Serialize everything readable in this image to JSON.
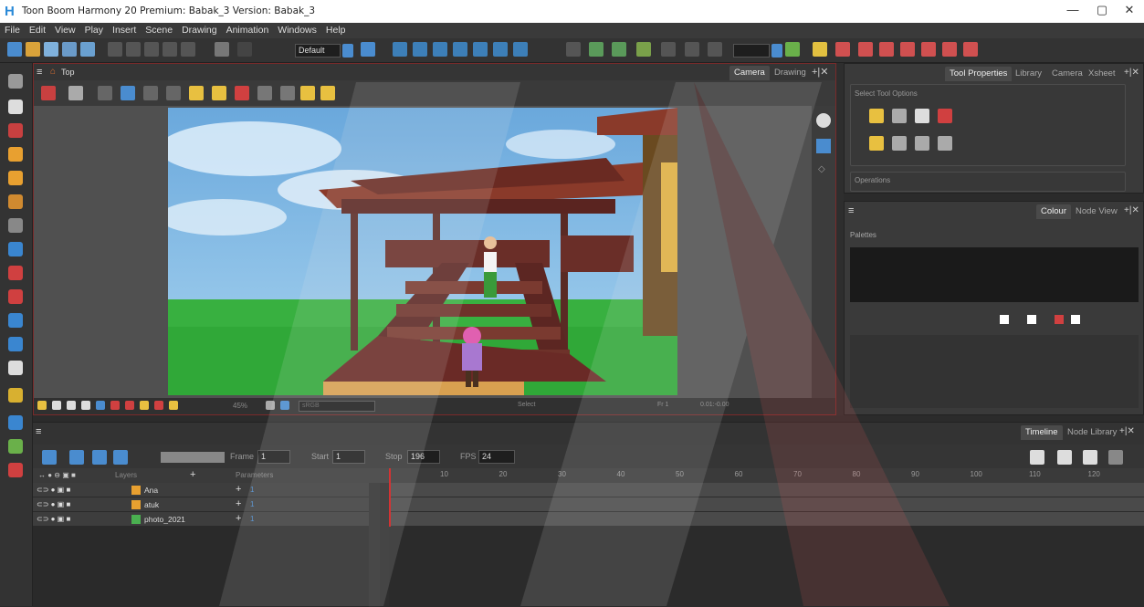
{
  "window": {
    "title": "Toon Boom Harmony 20 Premium: Babak_3 Version: Babak_3",
    "minimize": "—",
    "maximize": "▢",
    "close": "✕"
  },
  "menu": [
    "File",
    "Edit",
    "View",
    "Play",
    "Insert",
    "Scene",
    "Drawing",
    "Animation",
    "Windows",
    "Help"
  ],
  "toolbar": {
    "workspace": "Default"
  },
  "view": {
    "breadcrumb": "Top",
    "tabs": [
      "Camera",
      "Drawing"
    ],
    "footer": {
      "zoom": "45%",
      "colorspace": "sRGB",
      "status": "Select",
      "frame": "Fr 1",
      "coords": "0.01:-0.00"
    }
  },
  "right_top": {
    "tabs": [
      "Tool Properties",
      "Library",
      "Camera",
      "Xsheet"
    ],
    "select_tool_options": "Select Tool Options",
    "operations": "Operations"
  },
  "right_bottom": {
    "tabs": [
      "Colour",
      "Node View"
    ],
    "palettes": "Palettes"
  },
  "timeline": {
    "tabs": [
      "Timeline",
      "Node Library"
    ],
    "frame_label": "Frame",
    "frame": "1",
    "start_label": "Start",
    "start": "1",
    "stop_label": "Stop",
    "stop": "196",
    "fps_label": "FPS",
    "fps": "24",
    "layers_label": "Layers",
    "parameters_label": "Parameters",
    "layers": [
      {
        "name": "Ana",
        "value": "1"
      },
      {
        "name": "atuk",
        "value": "1"
      },
      {
        "name": "photo_2021",
        "value": "1"
      }
    ],
    "ruler": [
      "10",
      "20",
      "30",
      "40",
      "50",
      "60",
      "70",
      "80",
      "90",
      "100",
      "110",
      "120"
    ]
  },
  "colors": {
    "accent_red": "#7a2a2a",
    "panel": "#3a3a3a",
    "playhead": "#d01818"
  }
}
